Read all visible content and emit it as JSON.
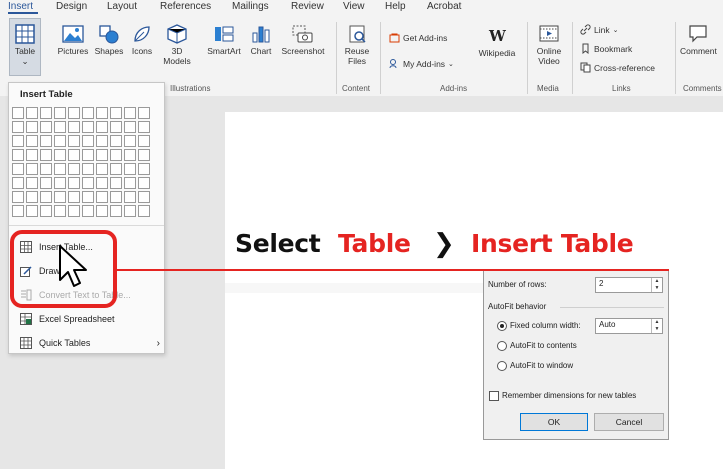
{
  "tabs": [
    "Insert",
    "Design",
    "Layout",
    "References",
    "Mailings",
    "Review",
    "View",
    "Help",
    "Acrobat"
  ],
  "ribbon": {
    "table": {
      "label": "Table",
      "chevron": "⌄"
    },
    "pictures": "Pictures",
    "shapes": "Shapes",
    "icons": "Icons",
    "models_3d": {
      "line1": "3D",
      "line2": "Models"
    },
    "smartart": "SmartArt",
    "chart": "Chart",
    "screenshot": "Screenshot",
    "reuse_files": {
      "line1": "Reuse",
      "line2": "Files"
    },
    "get_addins": "Get Add-ins",
    "my_addins": "My Add-ins",
    "wikipedia": "Wikipedia",
    "online_video": {
      "line1": "Online",
      "line2": "Video"
    },
    "link": "Link",
    "bookmark": "Bookmark",
    "cross_reference": "Cross-reference",
    "comment": "Comment",
    "groups": {
      "illustrations": "Illustrations",
      "content": "Content",
      "addins": "Add-ins",
      "media": "Media",
      "links": "Links",
      "comments": "Comments"
    }
  },
  "dropdown": {
    "title": "Insert Table",
    "items": {
      "insert_table": "Insert Table...",
      "draw_table": "Draw",
      "convert_text": "Convert Text to Table...",
      "excel": "Excel Spreadsheet",
      "quick_tables": "Quick Tables"
    }
  },
  "dialog": {
    "rows_label": "Number of rows:",
    "rows_value": "2",
    "autofit_heading": "AutoFit behavior",
    "fixed_label": "Fixed column width:",
    "fixed_value": "Auto",
    "autofit_contents": "AutoFit to contents",
    "autofit_window": "AutoFit to window",
    "remember": "Remember dimensions for new tables",
    "ok": "OK",
    "cancel": "Cancel"
  },
  "caption": {
    "select": "Select",
    "table": "Table",
    "arrow": "❯",
    "insert_table": "Insert Table"
  },
  "colors": {
    "accent_red": "#e52421",
    "word_blue": "#2b579a"
  }
}
